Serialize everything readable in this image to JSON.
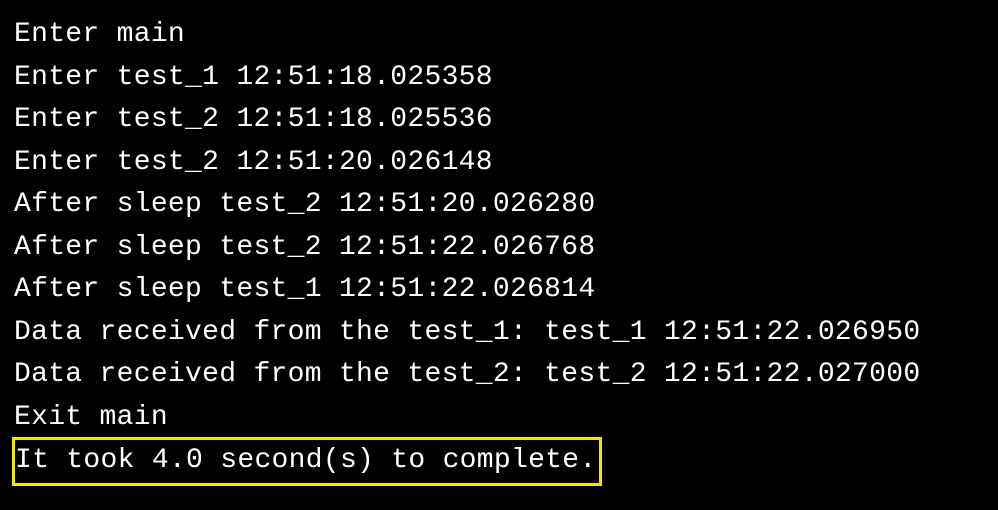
{
  "lines": {
    "l0": "Enter main",
    "l1": "Enter test_1 12:51:18.025358",
    "l2": "Enter test_2 12:51:18.025536",
    "l3": "Enter test_2 12:51:20.026148",
    "l4": "After sleep test_2 12:51:20.026280",
    "l5": "After sleep test_2 12:51:22.026768",
    "l6": "After sleep test_1 12:51:22.026814",
    "l7": "Data received from the test_1: test_1 12:51:22.026950",
    "l8": "Data received from the test_2: test_2 12:51:22.027000",
    "l9": "Exit main",
    "l10": "It took 4.0 second(s) to complete."
  }
}
